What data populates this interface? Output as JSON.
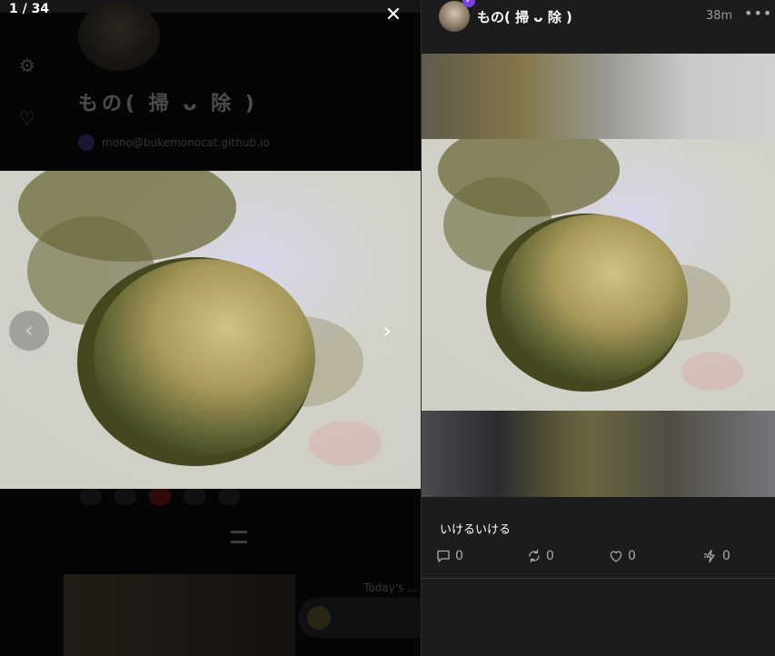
{
  "lightbox": {
    "counter": "1 / 34",
    "close_icon": "close-icon",
    "prev_icon": "chevron-left-icon",
    "next_icon": "chevron-right-icon"
  },
  "background_profile": {
    "name": "もの( 掃 ᴗ 除 )",
    "nip05": "mono@bukemonocat.github.io",
    "rail_icons": [
      "gear-icon",
      "heart-icon"
    ],
    "today_label": "Today's ..."
  },
  "note": {
    "author": "もの( 掃 ᴗ 除 )",
    "time": "38m",
    "more_icon": "more-icon",
    "content": "いけるいける",
    "actions": {
      "reply": {
        "icon": "reply-icon",
        "count": "0"
      },
      "repost": {
        "icon": "repost-icon",
        "count": "0"
      },
      "like": {
        "icon": "heart-icon",
        "count": "0"
      },
      "zap": {
        "icon": "zap-icon",
        "count": "0"
      }
    }
  },
  "colors": {
    "panel_bg": "#1c1c1c",
    "accent_purple": "#7a3fe0"
  }
}
